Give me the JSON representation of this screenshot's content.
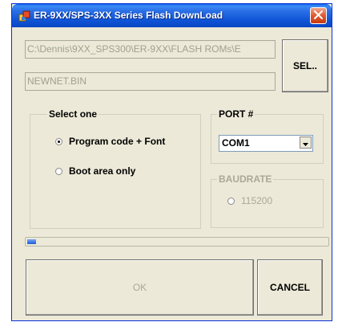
{
  "window": {
    "title": "ER-9XX/SPS-3XX Series Flash DownLoad"
  },
  "file": {
    "path_value": "C:\\Dennis\\9XX_SPS300\\ER-9XX\\FLASH ROMs\\E",
    "name_value": "NEWNET.BIN",
    "select_label": "SEL.."
  },
  "select_one": {
    "label": "Select one",
    "options": [
      {
        "label": "Program code + Font",
        "checked": true
      },
      {
        "label": "Boot area only",
        "checked": false
      }
    ]
  },
  "port": {
    "label": "PORT #",
    "value": "COM1"
  },
  "baudrate": {
    "label": "BAUDRATE",
    "option": "115200"
  },
  "progress": {
    "value": 0.03
  },
  "buttons": {
    "ok": "OK",
    "cancel": "CANCEL"
  },
  "colors": {
    "titlebar": "#0a5ee8",
    "face": "#ece9d8",
    "progress": "#1f5bd6"
  },
  "icons": [
    "app-icon",
    "close-icon",
    "chevron-down-icon"
  ]
}
